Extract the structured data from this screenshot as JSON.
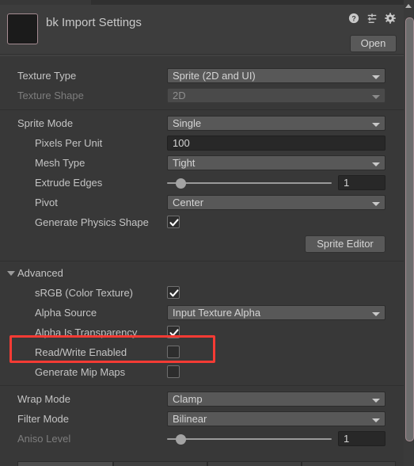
{
  "header": {
    "title": "bk Import Settings",
    "thumbnail_name": "texture-preview-thumbnail",
    "open_label": "Open",
    "icons": [
      {
        "name": "help-icon",
        "glyph": "?"
      },
      {
        "name": "preset-icon",
        "glyph": "preset"
      },
      {
        "name": "gear-icon",
        "glyph": "gear"
      }
    ]
  },
  "settings": {
    "texture_type": {
      "label": "Texture Type",
      "value": "Sprite (2D and UI)",
      "disabled": false
    },
    "texture_shape": {
      "label": "Texture Shape",
      "value": "2D",
      "disabled": true
    },
    "sprite_mode": {
      "label": "Sprite Mode",
      "value": "Single",
      "disabled": false
    },
    "pixels_per_unit": {
      "label": "Pixels Per Unit",
      "value": "100"
    },
    "mesh_type": {
      "label": "Mesh Type",
      "value": "Tight",
      "disabled": false
    },
    "extrude_edges": {
      "label": "Extrude Edges",
      "value": "1"
    },
    "pivot": {
      "label": "Pivot",
      "value": "Center",
      "disabled": false
    },
    "generate_physics_shape": {
      "label": "Generate Physics Shape",
      "checked": true
    },
    "sprite_editor_label": "Sprite Editor"
  },
  "advanced": {
    "header_label": "Advanced",
    "expanded": true,
    "srgb": {
      "label": "sRGB (Color Texture)",
      "checked": true
    },
    "alpha_source": {
      "label": "Alpha Source",
      "value": "Input Texture Alpha"
    },
    "alpha_is_transparency": {
      "label": "Alpha Is Transparency",
      "checked": true
    },
    "read_write_enabled": {
      "label": "Read/Write Enabled",
      "checked": false,
      "highlighted": true
    },
    "generate_mip_maps": {
      "label": "Generate Mip Maps",
      "checked": false
    }
  },
  "filtering": {
    "wrap_mode": {
      "label": "Wrap Mode",
      "value": "Clamp"
    },
    "filter_mode": {
      "label": "Filter Mode",
      "value": "Bilinear"
    },
    "aniso_level": {
      "label": "Aniso Level",
      "value": "1",
      "disabled": true
    }
  },
  "colors": {
    "background": "#383838",
    "header_background": "#3d3d3d",
    "dropdown": "#585858",
    "field": "#282828",
    "text": "#c4c4c4",
    "text_dim": "#7d7d7d",
    "highlight_red": "#f63b34",
    "thumbnail_border": "#a58c92"
  },
  "scrollbar": {
    "name": "vertical-scrollbar",
    "position": "top"
  }
}
